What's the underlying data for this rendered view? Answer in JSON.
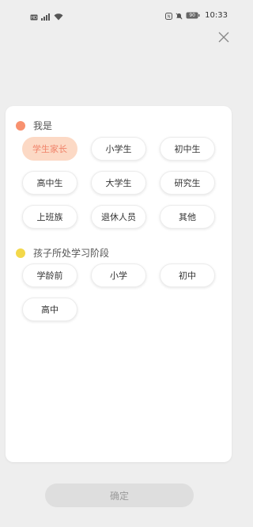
{
  "status_bar": {
    "time": "10:33",
    "battery_level": "90",
    "left_icons": [
      "hd-icon",
      "signal-icon",
      "wifi-icon"
    ],
    "right_icons": [
      "nfc-icon",
      "mute-icon",
      "battery-icon"
    ]
  },
  "dialog": {
    "close_icon": "close-icon",
    "sections": [
      {
        "title": "我是",
        "dot_color": "#f8916f",
        "options": [
          "学生家长",
          "小学生",
          "初中生",
          "高中生",
          "大学生",
          "研究生",
          "上班族",
          "退休人员",
          "其他"
        ],
        "selected": "学生家长"
      },
      {
        "title": "孩子所处学习阶段",
        "dot_color": "#f3d84a",
        "options": [
          "学龄前",
          "小学",
          "初中",
          "高中"
        ],
        "selected": ""
      }
    ],
    "confirm_label": "确定"
  },
  "colors": {
    "selected_bg": "#fcd9c5",
    "selected_text": "#f0836a",
    "confirm_bg": "#dedede",
    "confirm_text": "#9a9a9a",
    "background": "#eeeeee"
  }
}
